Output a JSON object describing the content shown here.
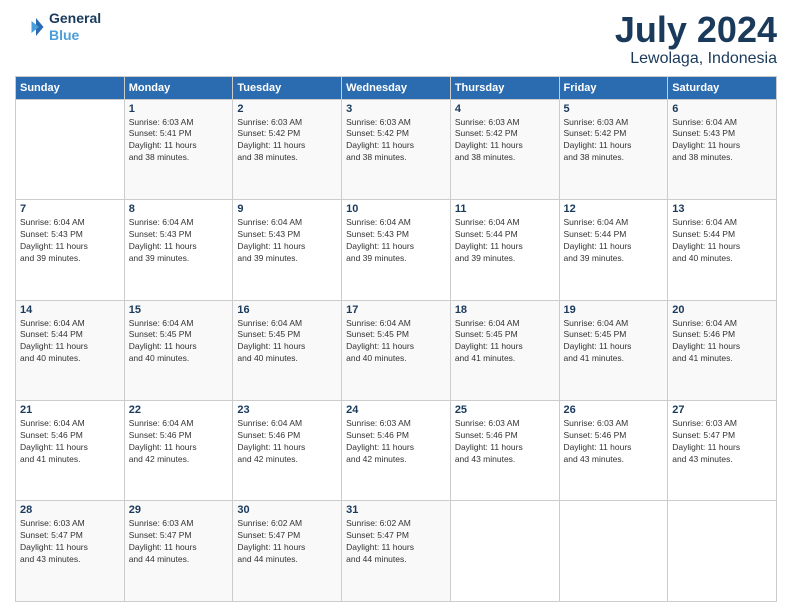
{
  "logo": {
    "line1": "General",
    "line2": "Blue"
  },
  "title": "July 2024",
  "location": "Lewolaga, Indonesia",
  "weekdays": [
    "Sunday",
    "Monday",
    "Tuesday",
    "Wednesday",
    "Thursday",
    "Friday",
    "Saturday"
  ],
  "weeks": [
    [
      {
        "day": "",
        "info": ""
      },
      {
        "day": "1",
        "info": "Sunrise: 6:03 AM\nSunset: 5:41 PM\nDaylight: 11 hours\nand 38 minutes."
      },
      {
        "day": "2",
        "info": "Sunrise: 6:03 AM\nSunset: 5:42 PM\nDaylight: 11 hours\nand 38 minutes."
      },
      {
        "day": "3",
        "info": "Sunrise: 6:03 AM\nSunset: 5:42 PM\nDaylight: 11 hours\nand 38 minutes."
      },
      {
        "day": "4",
        "info": "Sunrise: 6:03 AM\nSunset: 5:42 PM\nDaylight: 11 hours\nand 38 minutes."
      },
      {
        "day": "5",
        "info": "Sunrise: 6:03 AM\nSunset: 5:42 PM\nDaylight: 11 hours\nand 38 minutes."
      },
      {
        "day": "6",
        "info": "Sunrise: 6:04 AM\nSunset: 5:43 PM\nDaylight: 11 hours\nand 38 minutes."
      }
    ],
    [
      {
        "day": "7",
        "info": "Sunrise: 6:04 AM\nSunset: 5:43 PM\nDaylight: 11 hours\nand 39 minutes."
      },
      {
        "day": "8",
        "info": "Sunrise: 6:04 AM\nSunset: 5:43 PM\nDaylight: 11 hours\nand 39 minutes."
      },
      {
        "day": "9",
        "info": "Sunrise: 6:04 AM\nSunset: 5:43 PM\nDaylight: 11 hours\nand 39 minutes."
      },
      {
        "day": "10",
        "info": "Sunrise: 6:04 AM\nSunset: 5:43 PM\nDaylight: 11 hours\nand 39 minutes."
      },
      {
        "day": "11",
        "info": "Sunrise: 6:04 AM\nSunset: 5:44 PM\nDaylight: 11 hours\nand 39 minutes."
      },
      {
        "day": "12",
        "info": "Sunrise: 6:04 AM\nSunset: 5:44 PM\nDaylight: 11 hours\nand 39 minutes."
      },
      {
        "day": "13",
        "info": "Sunrise: 6:04 AM\nSunset: 5:44 PM\nDaylight: 11 hours\nand 40 minutes."
      }
    ],
    [
      {
        "day": "14",
        "info": "Sunrise: 6:04 AM\nSunset: 5:44 PM\nDaylight: 11 hours\nand 40 minutes."
      },
      {
        "day": "15",
        "info": "Sunrise: 6:04 AM\nSunset: 5:45 PM\nDaylight: 11 hours\nand 40 minutes."
      },
      {
        "day": "16",
        "info": "Sunrise: 6:04 AM\nSunset: 5:45 PM\nDaylight: 11 hours\nand 40 minutes."
      },
      {
        "day": "17",
        "info": "Sunrise: 6:04 AM\nSunset: 5:45 PM\nDaylight: 11 hours\nand 40 minutes."
      },
      {
        "day": "18",
        "info": "Sunrise: 6:04 AM\nSunset: 5:45 PM\nDaylight: 11 hours\nand 41 minutes."
      },
      {
        "day": "19",
        "info": "Sunrise: 6:04 AM\nSunset: 5:45 PM\nDaylight: 11 hours\nand 41 minutes."
      },
      {
        "day": "20",
        "info": "Sunrise: 6:04 AM\nSunset: 5:46 PM\nDaylight: 11 hours\nand 41 minutes."
      }
    ],
    [
      {
        "day": "21",
        "info": "Sunrise: 6:04 AM\nSunset: 5:46 PM\nDaylight: 11 hours\nand 41 minutes."
      },
      {
        "day": "22",
        "info": "Sunrise: 6:04 AM\nSunset: 5:46 PM\nDaylight: 11 hours\nand 42 minutes."
      },
      {
        "day": "23",
        "info": "Sunrise: 6:04 AM\nSunset: 5:46 PM\nDaylight: 11 hours\nand 42 minutes."
      },
      {
        "day": "24",
        "info": "Sunrise: 6:03 AM\nSunset: 5:46 PM\nDaylight: 11 hours\nand 42 minutes."
      },
      {
        "day": "25",
        "info": "Sunrise: 6:03 AM\nSunset: 5:46 PM\nDaylight: 11 hours\nand 43 minutes."
      },
      {
        "day": "26",
        "info": "Sunrise: 6:03 AM\nSunset: 5:46 PM\nDaylight: 11 hours\nand 43 minutes."
      },
      {
        "day": "27",
        "info": "Sunrise: 6:03 AM\nSunset: 5:47 PM\nDaylight: 11 hours\nand 43 minutes."
      }
    ],
    [
      {
        "day": "28",
        "info": "Sunrise: 6:03 AM\nSunset: 5:47 PM\nDaylight: 11 hours\nand 43 minutes."
      },
      {
        "day": "29",
        "info": "Sunrise: 6:03 AM\nSunset: 5:47 PM\nDaylight: 11 hours\nand 44 minutes."
      },
      {
        "day": "30",
        "info": "Sunrise: 6:02 AM\nSunset: 5:47 PM\nDaylight: 11 hours\nand 44 minutes."
      },
      {
        "day": "31",
        "info": "Sunrise: 6:02 AM\nSunset: 5:47 PM\nDaylight: 11 hours\nand 44 minutes."
      },
      {
        "day": "",
        "info": ""
      },
      {
        "day": "",
        "info": ""
      },
      {
        "day": "",
        "info": ""
      }
    ]
  ]
}
